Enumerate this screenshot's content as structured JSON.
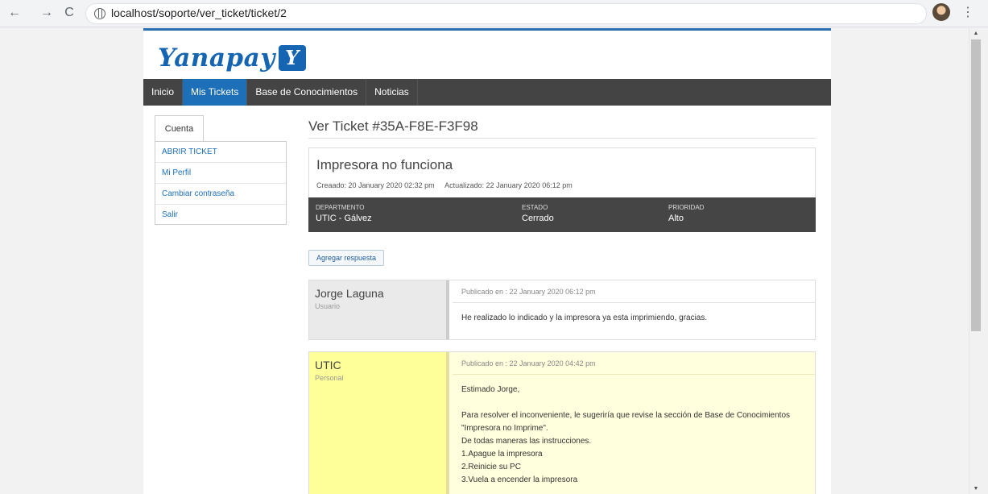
{
  "browser": {
    "url": "localhost/soporte/ver_ticket/ticket/2",
    "back_icon": "←",
    "forward_icon": "→",
    "reload_icon": "C"
  },
  "logo": {
    "text": "Yanapay",
    "mark": "Y"
  },
  "menu": {
    "items": [
      "Inicio",
      "Mis Tickets",
      "Base de Conocimientos",
      "Noticias"
    ],
    "active": "Mis Tickets"
  },
  "sidebar": {
    "tab": "Cuenta",
    "links": [
      "ABRIR TICKET",
      "Mi Perfil",
      "Cambiar contraseña",
      "Salir"
    ]
  },
  "ticket": {
    "title": "Ver Ticket #35A-F8E-F3F98",
    "subject": "Impresora no funciona",
    "created": "Creaado: 20 January 2020 02:32 pm",
    "updated": "Actualizado: 22 January 2020 06:12 pm",
    "department_label": "DEPARTMENTO",
    "department": "UTIC - Gálvez",
    "status_label": "ESTADO",
    "status": "Cerrado",
    "priority_label": "PRIORIDAD",
    "priority": "Alto"
  },
  "reply_button": "Agregar respuesta",
  "messages": [
    {
      "author": "Jorge Laguna",
      "role": "Usuario",
      "published": "Publicado en : 22 January 2020 06:12 pm",
      "body": [
        "He realizado lo indicado y la impresora ya esta imprimiendo, gracias."
      ]
    },
    {
      "author": "UTIC",
      "role": "Personal",
      "published": "Publicado en : 22 January 2020 04:42 pm",
      "body": [
        "Estimado Jorge,",
        "Para resolver el inconveniente, le sugeriría que revise la sección de Base de Conocimientos",
        "\"Impresora no Imprime\".",
        "De todas maneras las instrucciones.",
        "1.Apague la impresora",
        "2.Reinicie su PC",
        "3.Vuela a encender la impresora"
      ]
    }
  ]
}
